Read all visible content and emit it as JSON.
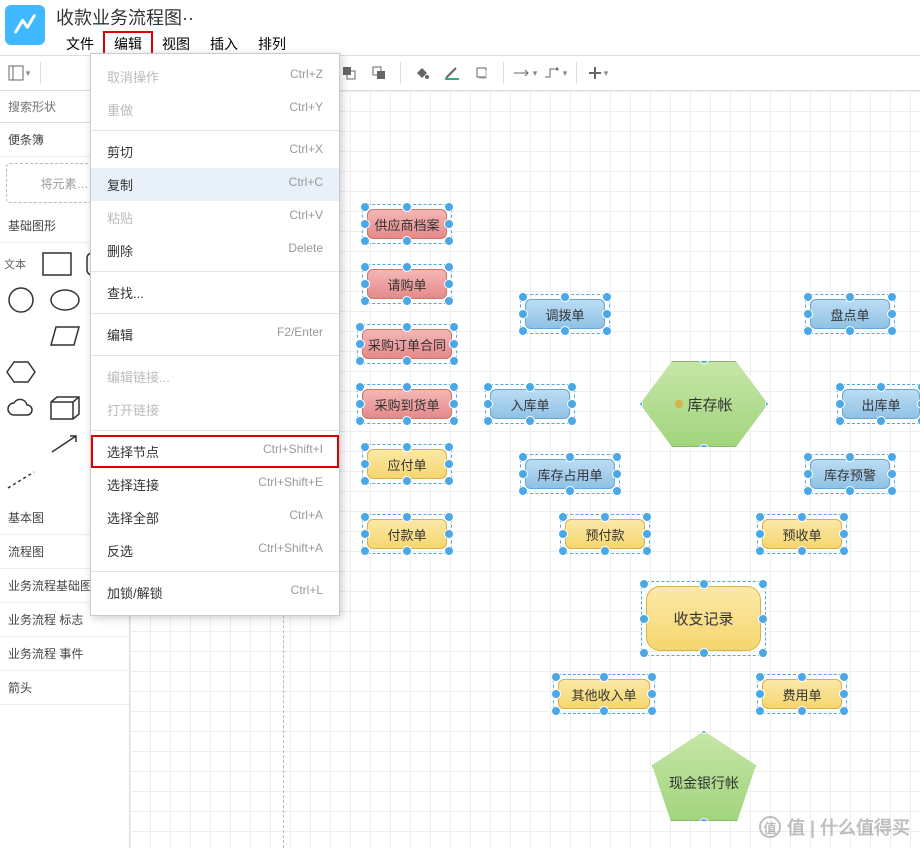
{
  "title": "收款业务流程图··",
  "menu": {
    "file": "文件",
    "edit": "编辑",
    "view": "视图",
    "insert": "插入",
    "arrange": "排列"
  },
  "sidebar": {
    "search_ph": "搜索形状",
    "scratch": "便条簿",
    "dropzone": "将元素…",
    "basic": "基础图形",
    "textlbl": "文本",
    "cats": [
      "基本图",
      "流程图",
      "业务流程基础图",
      "业务流程 标志",
      "业务流程 事件",
      "箭头"
    ]
  },
  "dropdown": [
    {
      "t": "取消操作",
      "k": "Ctrl+Z",
      "s": "disabled"
    },
    {
      "t": "重做",
      "k": "Ctrl+Y",
      "s": "disabled"
    },
    {
      "sep": true
    },
    {
      "t": "剪切",
      "k": "Ctrl+X"
    },
    {
      "t": "复制",
      "k": "Ctrl+C",
      "s": "hover"
    },
    {
      "t": "粘贴",
      "k": "Ctrl+V",
      "s": "disabled"
    },
    {
      "t": "删除",
      "k": "Delete"
    },
    {
      "sep": true
    },
    {
      "t": "查找...",
      "k": ""
    },
    {
      "sep": true
    },
    {
      "t": "编辑",
      "k": "F2/Enter"
    },
    {
      "sep": true
    },
    {
      "t": "编辑链接...",
      "k": "",
      "s": "disabled"
    },
    {
      "t": "打开链接",
      "k": "",
      "s": "disabled"
    },
    {
      "sep": true
    },
    {
      "t": "选择节点",
      "k": "Ctrl+Shift+I",
      "s": "hl"
    },
    {
      "t": "选择连接",
      "k": "Ctrl+Shift+E"
    },
    {
      "t": "选择全部",
      "k": "Ctrl+A"
    },
    {
      "t": "反选",
      "k": "Ctrl+Shift+A"
    },
    {
      "sep": true
    },
    {
      "t": "加锁/解锁",
      "k": "Ctrl+L"
    }
  ],
  "nodes": {
    "supplier": "供应商档案",
    "requisition": "请购单",
    "transfer": "调拨单",
    "count": "盘点单",
    "po": "采购订单合同",
    "receipt": "采购到货单",
    "inbound": "入库单",
    "inventory": "库存帐",
    "outbound": "出库单",
    "payable": "应付单",
    "occupy": "库存占用单",
    "warning": "库存预警",
    "payment": "付款单",
    "prepay": "预付款",
    "prereceipt": "预收单",
    "ledger": "收支记录",
    "otherin": "其他收入单",
    "expense": "费用单",
    "cash": "现金银行帐"
  },
  "watermark": "值 | 什么值得买"
}
